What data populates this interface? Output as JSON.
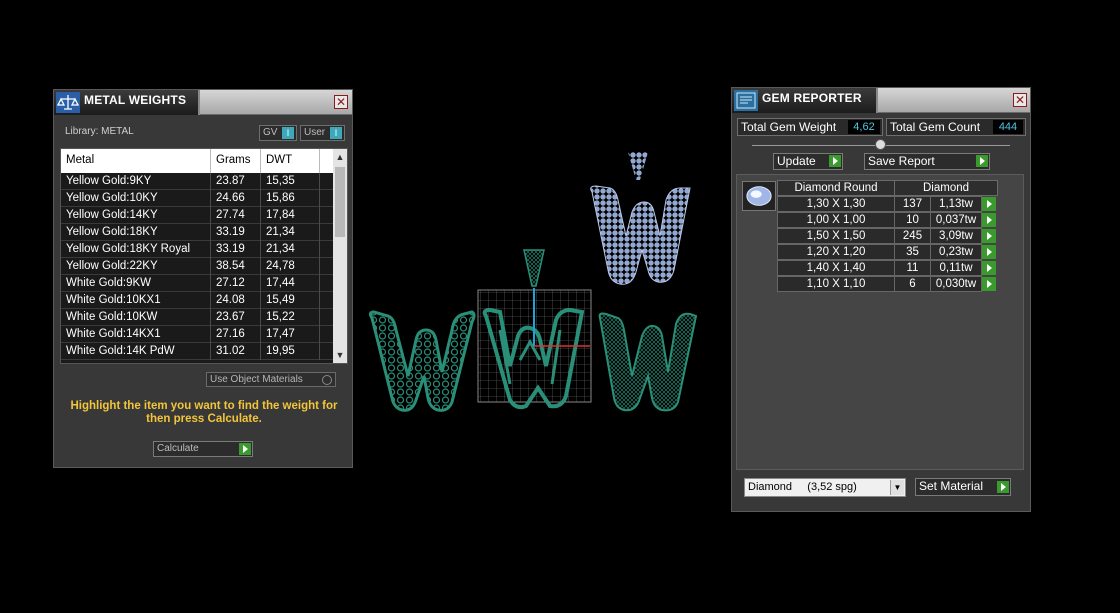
{
  "metal_weights": {
    "title": "METAL WEIGHTS",
    "close": "✕",
    "library_label": "Library: METAL",
    "toggle_gv": "GV",
    "toggle_user": "User",
    "toggle_key": "I",
    "columns": [
      "Metal",
      "Grams",
      "DWT"
    ],
    "rows": [
      {
        "metal": "Yellow Gold:9KY",
        "grams": "23.87",
        "dwt": "15,35"
      },
      {
        "metal": "Yellow Gold:10KY",
        "grams": "24.66",
        "dwt": "15,86"
      },
      {
        "metal": "Yellow Gold:14KY",
        "grams": "27.74",
        "dwt": "17,84"
      },
      {
        "metal": "Yellow Gold:18KY",
        "grams": "33.19",
        "dwt": "21,34"
      },
      {
        "metal": "Yellow Gold:18KY Royal",
        "grams": "33.19",
        "dwt": "21,34"
      },
      {
        "metal": "Yellow Gold:22KY",
        "grams": "38.54",
        "dwt": "24,78"
      },
      {
        "metal": "White Gold:9KW",
        "grams": "27.12",
        "dwt": "17,44"
      },
      {
        "metal": "White Gold:10KX1",
        "grams": "24.08",
        "dwt": "15,49"
      },
      {
        "metal": "White Gold:10KW",
        "grams": "23.67",
        "dwt": "15,22"
      },
      {
        "metal": "White Gold:14KX1",
        "grams": "27.16",
        "dwt": "17,47"
      },
      {
        "metal": "White Gold:14K PdW",
        "grams": "31.02",
        "dwt": "19,95"
      }
    ],
    "use_object_materials": "Use Object Materials",
    "hint": "Highlight the item you want to find the weight for then press Calculate.",
    "calculate": "Calculate"
  },
  "gem_reporter": {
    "title": "GEM REPORTER",
    "close": "✕",
    "total_weight_label": "Total Gem Weight",
    "total_weight_value": "4,62",
    "total_count_label": "Total Gem Count",
    "total_count_value": "444",
    "update": "Update",
    "save_report": "Save Report",
    "header_shape": "Diamond Round",
    "header_material": "Diamond",
    "gems": [
      {
        "size": "1,30 X 1,30",
        "count": "137",
        "weight": "1,13tw"
      },
      {
        "size": "1,00 X 1,00",
        "count": "10",
        "weight": "0,037tw"
      },
      {
        "size": "1,50 X 1,50",
        "count": "245",
        "weight": "3,09tw"
      },
      {
        "size": "1,20 X 1,20",
        "count": "35",
        "weight": "0,23tw"
      },
      {
        "size": "1,40 X 1,40",
        "count": "11",
        "weight": "0,11tw"
      },
      {
        "size": "1,10 X 1,10",
        "count": "6",
        "weight": "0,030tw"
      }
    ],
    "material_select": "Diamond     (3,52 spg)",
    "set_material": "Set Material"
  },
  "colors": {
    "background": "#000000",
    "panel": "#383838",
    "accent_cyan": "#52c5e0",
    "hint_yellow": "#f2c53a",
    "model_green": "#2a8f78",
    "model_blue": "#8fa8d8"
  }
}
